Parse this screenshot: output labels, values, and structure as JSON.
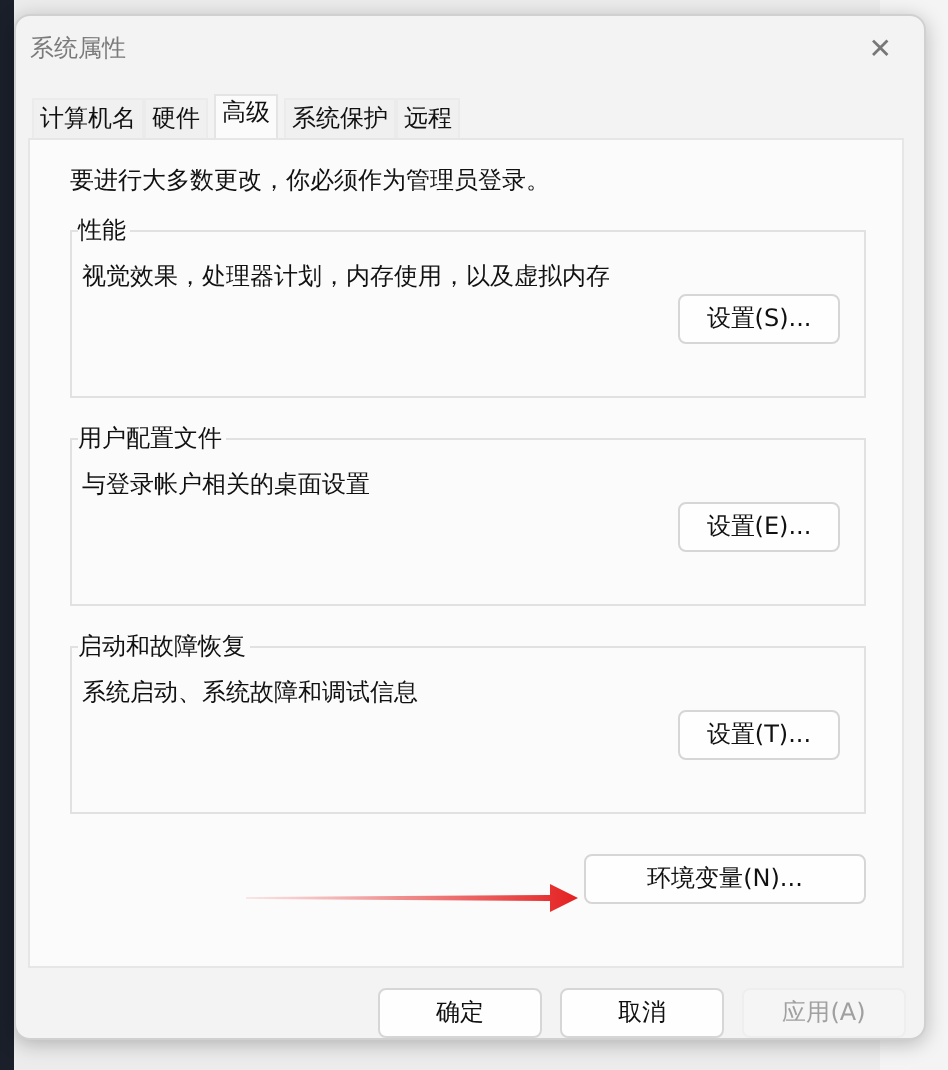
{
  "window": {
    "title": "系统属性",
    "close": "✕"
  },
  "tabs": [
    {
      "label": "计算机名",
      "selected": false
    },
    {
      "label": "硬件",
      "selected": false
    },
    {
      "label": "高级",
      "selected": true
    },
    {
      "label": "系统保护",
      "selected": false
    },
    {
      "label": "远程",
      "selected": false
    }
  ],
  "notice": "要进行大多数更改，你必须作为管理员登录。",
  "groups": [
    {
      "title": "性能",
      "description": "视觉效果，处理器计划，内存使用，以及虚拟内存",
      "button": "设置(S)..."
    },
    {
      "title": "用户配置文件",
      "description": "与登录帐户相关的桌面设置",
      "button": "设置(E)..."
    },
    {
      "title": "启动和故障恢复",
      "description": "系统启动、系统故障和调试信息",
      "button": "设置(T)..."
    }
  ],
  "env_button": "环境变量(N)...",
  "footer_buttons": [
    {
      "label": "确定",
      "disabled": false
    },
    {
      "label": "取消",
      "disabled": false
    },
    {
      "label": "应用(A)",
      "disabled": true
    }
  ]
}
